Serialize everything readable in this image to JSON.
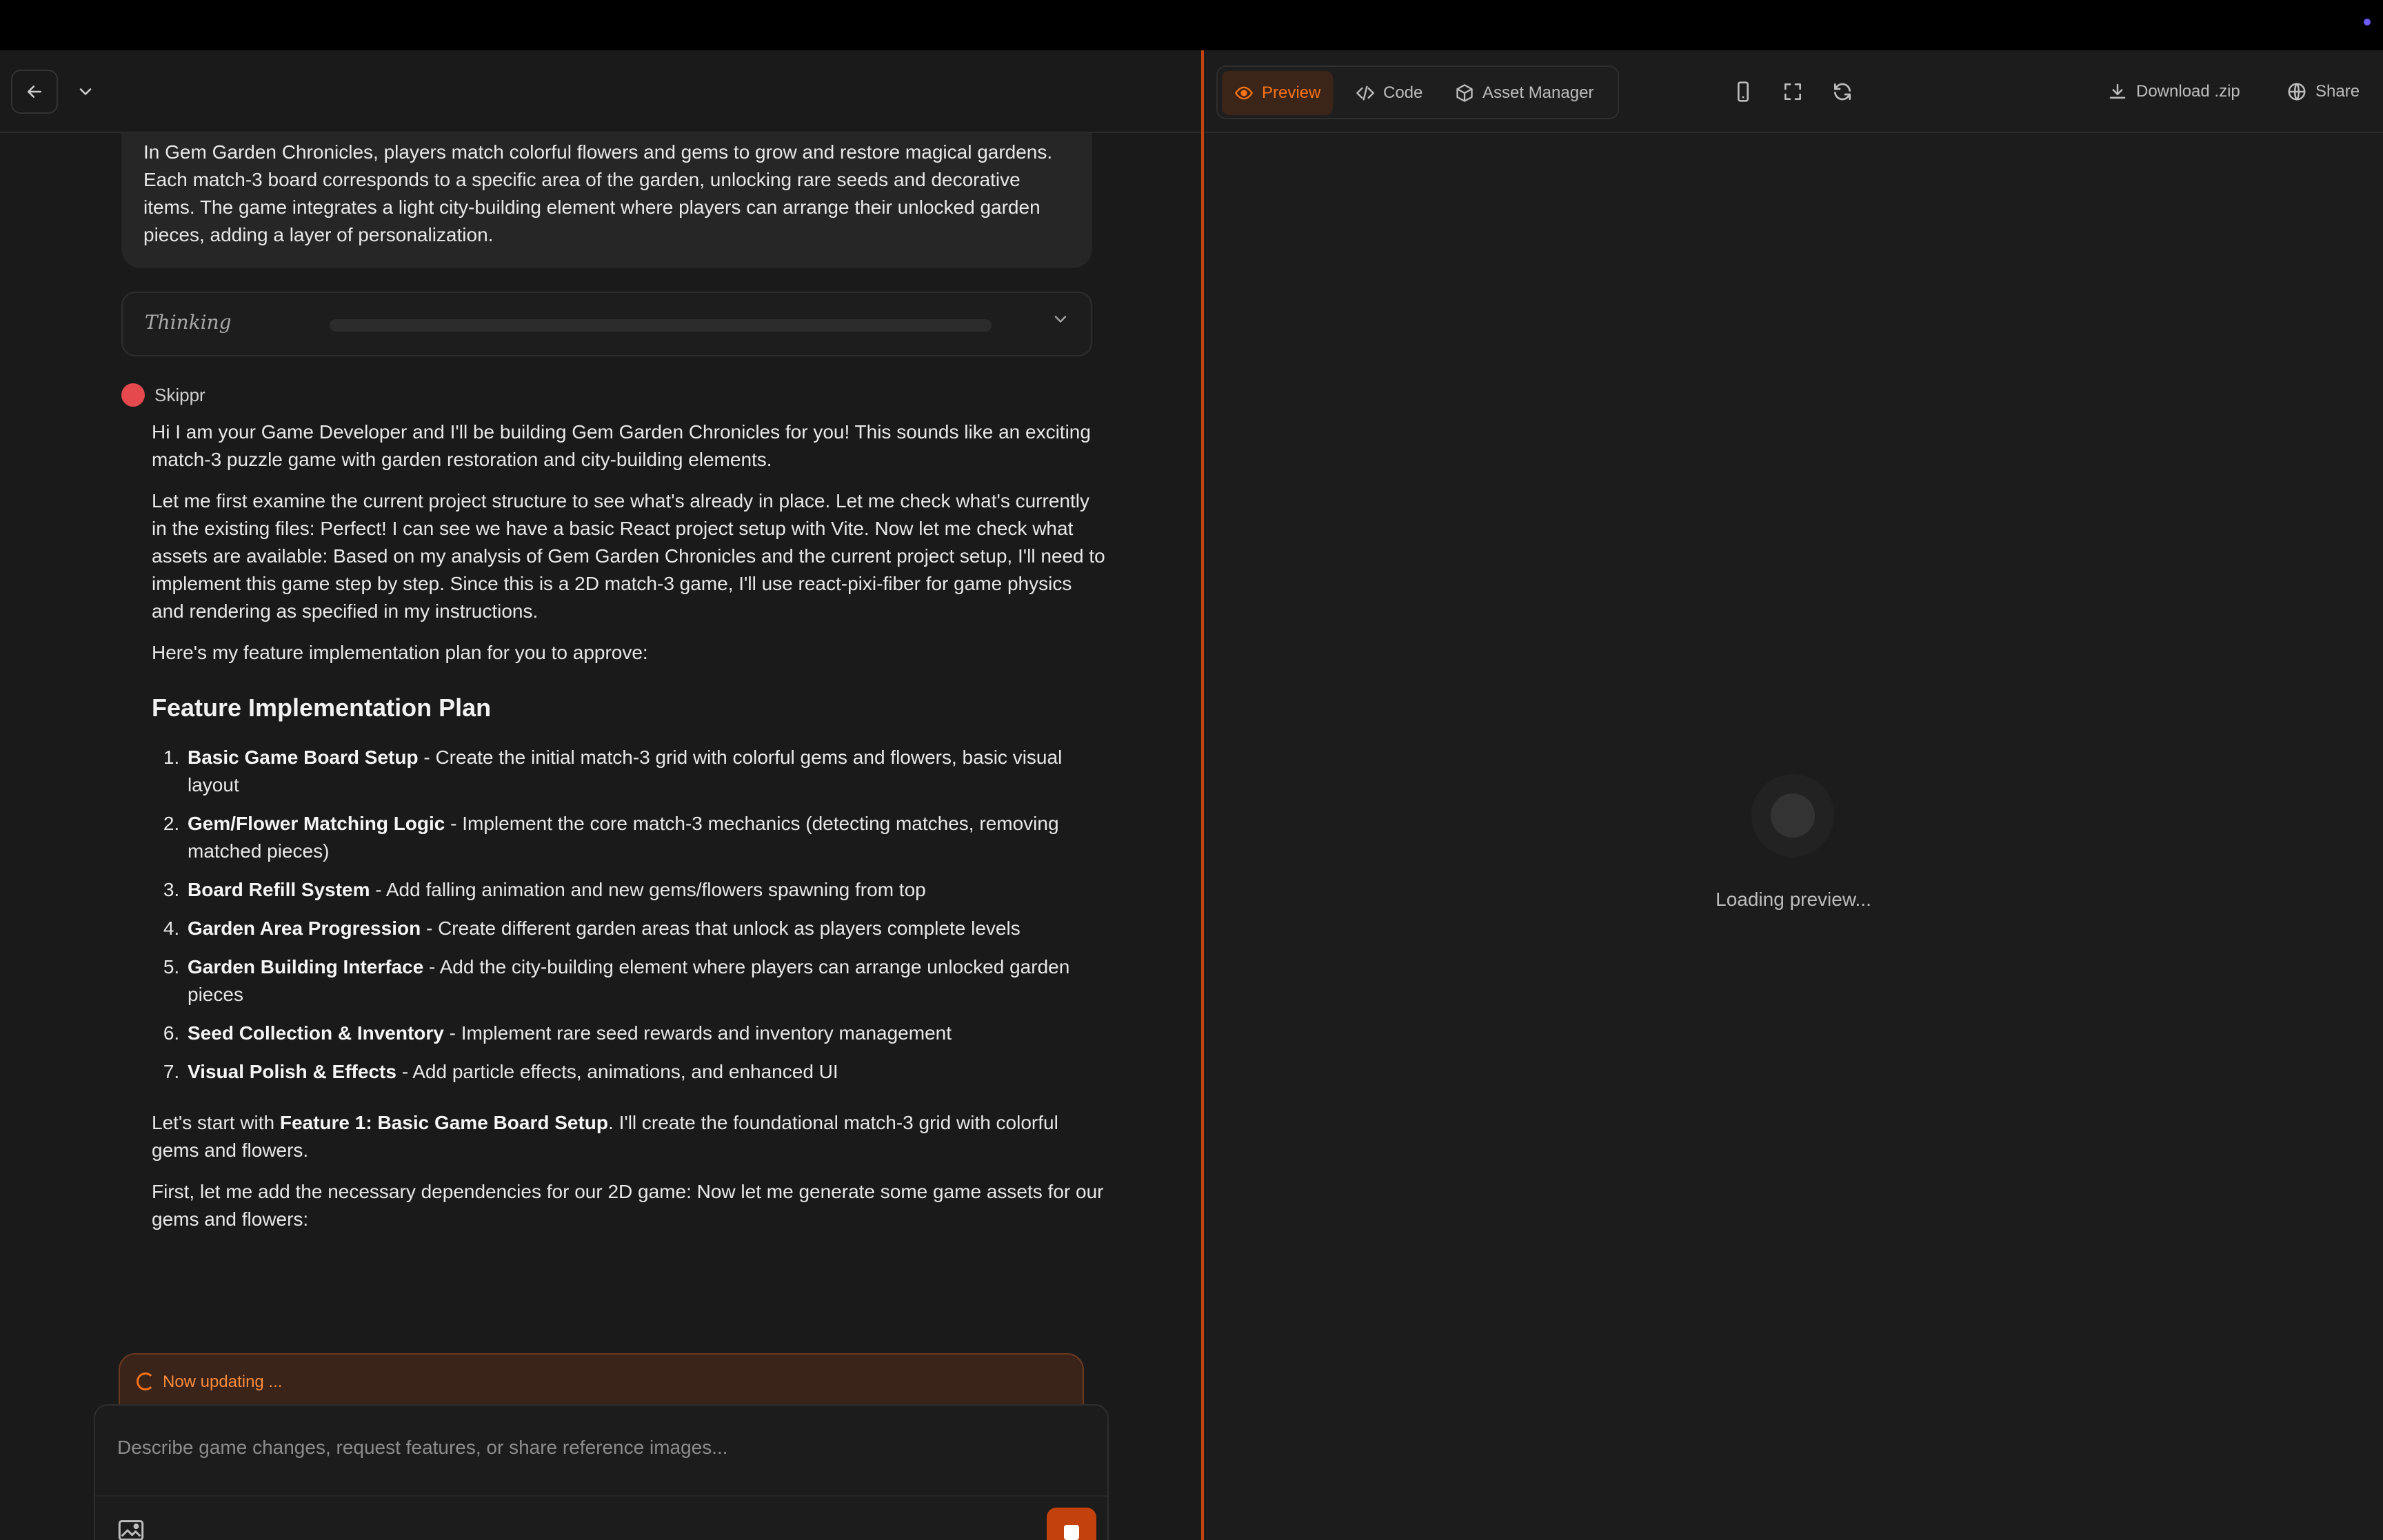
{
  "header": {
    "back_icon": "arrow-left-icon",
    "dropdown_icon": "chevron-down-icon"
  },
  "user_message": "In Gem Garden Chronicles, players match colorful flowers and gems to grow and restore magical gardens. Each match-3 board corresponds to a specific area of the garden, unlocking rare seeds and decorative items. The game integrates a light city-building element where players can arrange their unlocked garden pieces, adding a layer of personalization.",
  "thinking": {
    "label": "Thinking"
  },
  "assistant": {
    "name": "Skippr",
    "avatar_color": "#e5484d",
    "intro": "Hi I am your Game Developer and I'll be building Gem Garden Chronicles for you! This sounds like an exciting match-3 puzzle game with garden restoration and city-building elements.",
    "analysis": "Let me first examine the current project structure to see what's already in place. Let me check what's currently in the existing files: Perfect! I can see we have a basic React project setup with Vite. Now let me check what assets are available: Based on my analysis of Gem Garden Chronicles and the current project setup, I'll need to implement this game step by step. Since this is a 2D match-3 game, I'll use react-pixi-fiber for game physics and rendering as specified in my instructions.",
    "plan_intro": "Here's my feature implementation plan for you to approve:",
    "plan_heading": "Feature Implementation Plan",
    "plan_items": [
      {
        "title": "Basic Game Board Setup",
        "desc": " - Create the initial match-3 grid with colorful gems and flowers, basic visual layout"
      },
      {
        "title": "Gem/Flower Matching Logic",
        "desc": " - Implement the core match-3 mechanics (detecting matches, removing matched pieces)"
      },
      {
        "title": "Board Refill System",
        "desc": " - Add falling animation and new gems/flowers spawning from top"
      },
      {
        "title": "Garden Area Progression",
        "desc": " - Create different garden areas that unlock as players complete levels"
      },
      {
        "title": "Garden Building Interface",
        "desc": " - Add the city-building element where players can arrange unlocked garden pieces"
      },
      {
        "title": "Seed Collection & Inventory",
        "desc": " - Implement rare seed rewards and inventory management"
      },
      {
        "title": "Visual Polish & Effects",
        "desc": " - Add particle effects, animations, and enhanced UI"
      }
    ],
    "start_pre": "Let's start with ",
    "start_bold": "Feature 1: Basic Game Board Setup",
    "start_post": ". I'll create the foundational match-3 grid with colorful gems and flowers.",
    "deps": "First, let me add the necessary dependencies for our 2D game: Now let me generate some game assets for our gems and flowers:"
  },
  "status": {
    "updating": "Now updating ..."
  },
  "composer": {
    "placeholder": "Describe game changes, request features, or share reference images..."
  },
  "preview_panel": {
    "tabs": [
      {
        "label": "Preview",
        "icon": "eye-icon",
        "active": true
      },
      {
        "label": "Code",
        "icon": "code-icon",
        "active": false
      },
      {
        "label": "Asset Manager",
        "icon": "cube-icon",
        "active": false
      }
    ],
    "download_label": "Download .zip",
    "share_label": "Share",
    "loading_text": "Loading preview..."
  },
  "colors": {
    "accent": "#c2410c",
    "accent_text": "#f97316",
    "background": "#1a1a1a"
  }
}
